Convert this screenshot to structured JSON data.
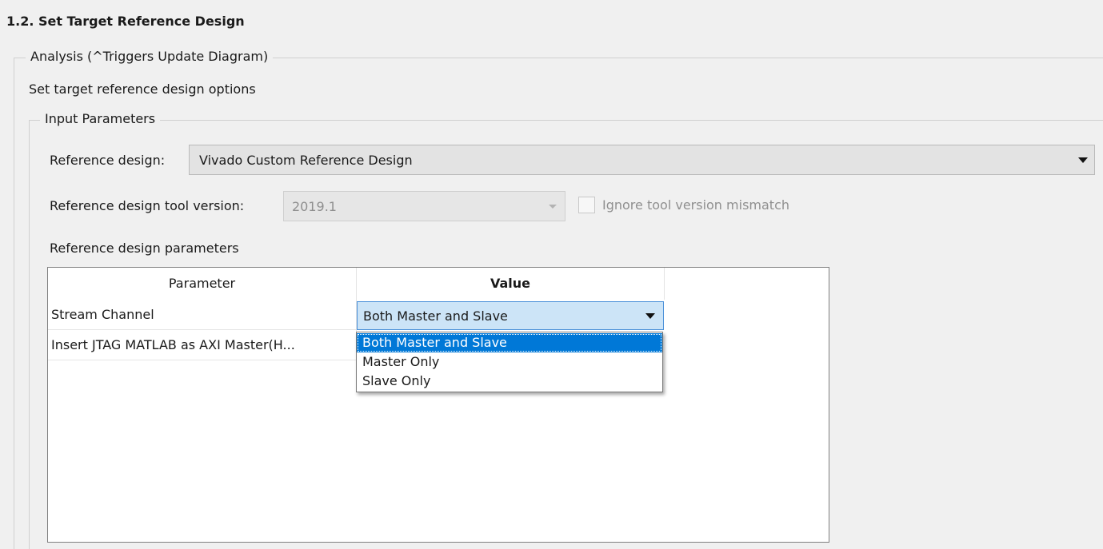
{
  "step": {
    "title": "1.2. Set Target Reference Design"
  },
  "analysis_group": {
    "legend": "Analysis (^Triggers Update Diagram)"
  },
  "description": "Set target reference design options",
  "input_parameters": {
    "legend": "Input Parameters",
    "reference_design": {
      "label": "Reference design:",
      "value": "Vivado Custom Reference Design"
    },
    "tool_version": {
      "label": "Reference design tool version:",
      "value": "2019.1",
      "enabled": false
    },
    "ignore_mismatch": {
      "label": "Ignore tool version mismatch",
      "checked": false,
      "enabled": false
    },
    "params_label": "Reference design parameters"
  },
  "params_table": {
    "columns": [
      "Parameter",
      "Value"
    ],
    "rows": [
      {
        "parameter": "Stream Channel",
        "value": "Both Master and Slave"
      },
      {
        "parameter": "Insert JTAG MATLAB as AXI Master(H...",
        "value": ""
      }
    ]
  },
  "dropdown": {
    "options": [
      "Both Master and Slave",
      "Master Only",
      "Slave Only"
    ],
    "selected": "Both Master and Slave"
  },
  "colors": {
    "selection": "#0078d7",
    "cell_focus": "#cce4f7",
    "background": "#f0f0f0"
  }
}
